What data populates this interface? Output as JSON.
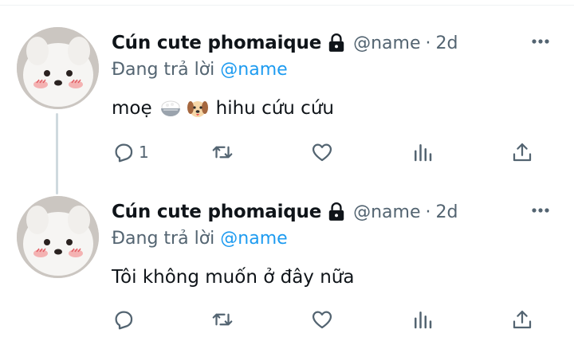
{
  "tweets": [
    {
      "display_name": "Cún cute phomaique",
      "handle": "@name",
      "separator": "·",
      "age": "2d",
      "reply_prefix": "Đang trả lời",
      "reply_to": "@name",
      "text_before": "moẹ",
      "text_after": "hihu cứu cứu",
      "emojis": [
        "rice-bowl-icon",
        "dog-face-icon"
      ],
      "reply_count": "1"
    },
    {
      "display_name": "Cún cute phomaique",
      "handle": "@name",
      "separator": "·",
      "age": "2d",
      "reply_prefix": "Đang trả lời",
      "reply_to": "@name",
      "text": "Tôi không muốn ở đây nữa",
      "reply_count": ""
    }
  ],
  "icons": {
    "locked": "lock-icon",
    "more": "more-icon",
    "reply": "reply-icon",
    "retweet": "retweet-icon",
    "like": "heart-icon",
    "views": "views-icon",
    "share": "share-icon"
  },
  "colors": {
    "text": "#0f1419",
    "secondary": "#536471",
    "mention": "#1d9bf0",
    "thread_line": "#cfd9de"
  }
}
